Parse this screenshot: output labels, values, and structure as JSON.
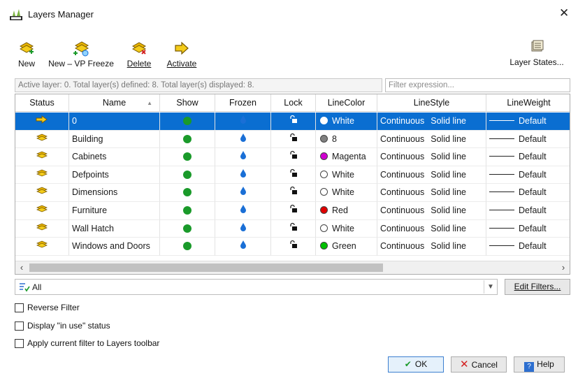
{
  "window": {
    "title": "Layers Manager"
  },
  "toolbar": {
    "new_label": "New",
    "new_vp_freeze_label": "New – VP Freeze",
    "delete_label": "Delete",
    "activate_label": "Activate",
    "layer_states_label": "Layer States..."
  },
  "info_text": "Active layer: 0. Total layer(s) defined: 8. Total layer(s) displayed: 8.",
  "filter_expression": {
    "placeholder": "Filter expression..."
  },
  "columns": [
    "Status",
    "Name",
    "Show",
    "Frozen",
    "Lock",
    "LineColor",
    "LineStyle",
    "LineWeight"
  ],
  "layers": [
    {
      "name": "0",
      "color_name": "White",
      "color_hex": "#ffffff",
      "linestyle": "Continuous",
      "linestyle_desc": "Solid line",
      "lineweight": "Default",
      "active": true
    },
    {
      "name": "Building",
      "color_name": "8",
      "color_hex": "#808080",
      "linestyle": "Continuous",
      "linestyle_desc": "Solid line",
      "lineweight": "Default",
      "active": false
    },
    {
      "name": "Cabinets",
      "color_name": "Magenta",
      "color_hex": "#d000d0",
      "linestyle": "Continuous",
      "linestyle_desc": "Solid line",
      "lineweight": "Default",
      "active": false
    },
    {
      "name": "Defpoints",
      "color_name": "White",
      "color_hex": "#ffffff",
      "linestyle": "Continuous",
      "linestyle_desc": "Solid line",
      "lineweight": "Default",
      "active": false
    },
    {
      "name": "Dimensions",
      "color_name": "White",
      "color_hex": "#ffffff",
      "linestyle": "Continuous",
      "linestyle_desc": "Solid line",
      "lineweight": "Default",
      "active": false
    },
    {
      "name": "Furniture",
      "color_name": "Red",
      "color_hex": "#e00000",
      "linestyle": "Continuous",
      "linestyle_desc": "Solid line",
      "lineweight": "Default",
      "active": false
    },
    {
      "name": "Wall Hatch",
      "color_name": "White",
      "color_hex": "#ffffff",
      "linestyle": "Continuous",
      "linestyle_desc": "Solid line",
      "lineweight": "Default",
      "active": false
    },
    {
      "name": "Windows and Doors",
      "color_name": "Green",
      "color_hex": "#00c000",
      "linestyle": "Continuous",
      "linestyle_desc": "Solid line",
      "lineweight": "Default",
      "active": false
    }
  ],
  "filter": {
    "selected": "All",
    "edit_filters_label": "Edit Filters..."
  },
  "options": {
    "reverse_filter": "Reverse Filter",
    "display_in_use": "Display \"in use\" status",
    "apply_current_filter": "Apply current filter to Layers toolbar"
  },
  "buttons": {
    "ok": "OK",
    "cancel": "Cancel",
    "help": "Help"
  },
  "colors": {
    "selection": "#0a6ed1",
    "show_on": "#1a9a2a",
    "frozen_drop": "#1a6fd6",
    "layer_icon": "#e8b400"
  }
}
